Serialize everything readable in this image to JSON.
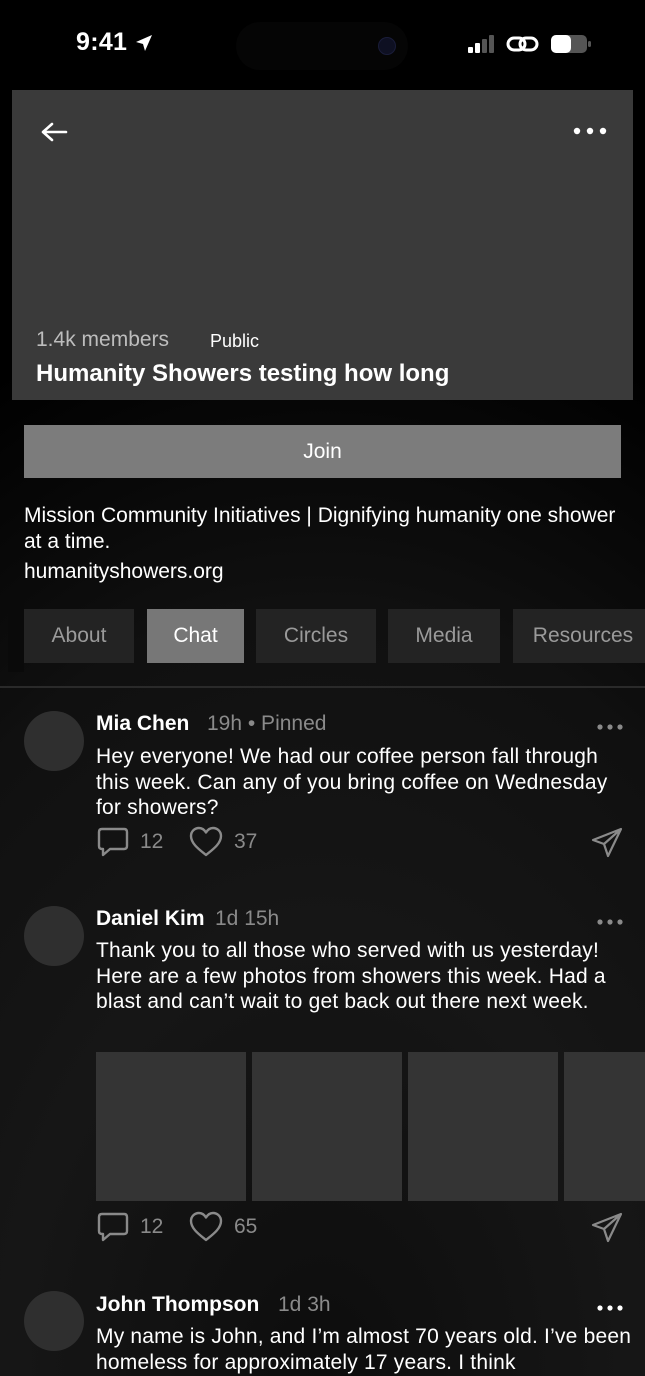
{
  "status_bar": {
    "time": "9:41"
  },
  "group": {
    "members": "1.4k members",
    "visibility": "Public",
    "title": "Humanity Showers testing how long",
    "join_label": "Join",
    "description": "Mission Community Initiatives | Dignifying humanity one shower at a time.",
    "website": "humanityshowers.org"
  },
  "tabs": [
    {
      "label": "About",
      "active": false
    },
    {
      "label": "Chat",
      "active": true
    },
    {
      "label": "Circles",
      "active": false
    },
    {
      "label": "Media",
      "active": false
    },
    {
      "label": "Resources",
      "active": false
    }
  ],
  "posts": [
    {
      "author": "Mia Chen",
      "meta": "19h • Pinned",
      "text": "Hey everyone! We had our coffee person fall through this week. Can any of you bring coffee on Wednesday for showers?",
      "comments": "12",
      "likes": "37"
    },
    {
      "author": "Daniel Kim",
      "meta": "1d 15h",
      "text": "Thank you to all those who served with us yesterday! Here are a few photos from showers this week. Had a blast and can’t wait to get back out there next week.",
      "comments": "12",
      "likes": "65",
      "photo_count": 4
    },
    {
      "author": "John Thompson",
      "meta": "1d 3h",
      "text": "My name is John, and I’m almost 70 years old. I’ve been homeless for approximately 17 years. I think"
    }
  ],
  "icons": {
    "status": [
      "location-arrow-icon",
      "signal-icon",
      "link-icon",
      "battery-icon"
    ],
    "header": [
      "back-arrow-icon",
      "more-icon"
    ],
    "post_actions": [
      "comment-icon",
      "heart-icon",
      "send-icon",
      "more-icon"
    ]
  },
  "colors": {
    "background": "#000000",
    "header_card": "#3a3a3a",
    "join_button": "#7c7c7c",
    "tab_inactive": "#232323",
    "tab_active": "#777777",
    "muted_text": "#8a8a8a"
  }
}
